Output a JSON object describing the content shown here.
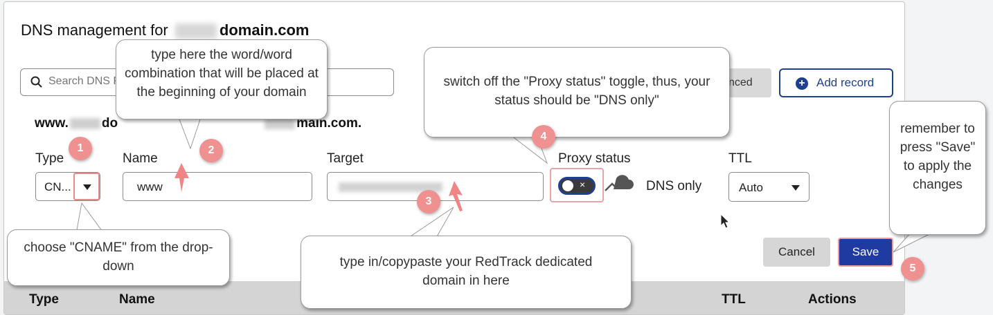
{
  "title": {
    "prefix": "DNS management for ",
    "domain": "domain.com"
  },
  "search": {
    "placeholder": "Search DNS R"
  },
  "buttons": {
    "advanced": "nced",
    "add_record": "Add record",
    "cancel": "Cancel",
    "save": "Save"
  },
  "record": {
    "hostname_prefix": "www.",
    "hostname_mid": "do",
    "hostname_suffix": "main.com.",
    "labels": {
      "type": "Type",
      "name": "Name",
      "target": "Target",
      "proxy": "Proxy status",
      "ttl": "TTL"
    },
    "type_value": "CN...",
    "name_value": "www",
    "proxy_toggle_glyph": "×",
    "proxy_text": "DNS only",
    "ttl_value": "Auto"
  },
  "table_header": [
    "Type",
    "Name",
    "TTL",
    "Actions"
  ],
  "callouts": {
    "c1": "choose \"CNAME\" from the drop-down",
    "c2": "type here the word/word combination that will be placed at the beginning of your domain",
    "c3": "type in/copypaste your RedTrack dedicated domain in here",
    "c4": "switch off the \"Proxy status\" toggle, thus, your status should be \"DNS only\"",
    "c5": "remember to press \"Save\" to apply the changes"
  },
  "badges": [
    "1",
    "2",
    "3",
    "4",
    "5"
  ],
  "icons": {
    "search": "search-icon",
    "plus": "plus-circle-icon",
    "cloud": "cloud-off-icon",
    "caret": "chevron-down-icon"
  },
  "colors": {
    "accent": "#1f3f8f",
    "save_bg": "#1f3aa0",
    "badge": "#ef9191",
    "highlight": "#e88a8a"
  }
}
